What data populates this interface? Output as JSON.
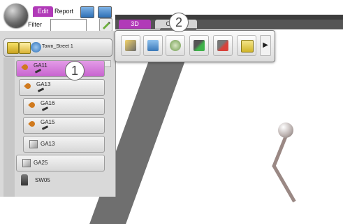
{
  "ribbon": {
    "tabs": [
      {
        "label": "Edit",
        "active": true
      },
      {
        "label": "Report",
        "active": false
      }
    ],
    "icons": [
      "view-icon",
      "save-view-icon"
    ]
  },
  "filter": {
    "label": "Filter",
    "value": ""
  },
  "view_tabs": [
    {
      "label": "3D",
      "active": true
    },
    {
      "label": "Ob  ons",
      "active": false
    }
  ],
  "tree": {
    "toolbar_label": "Town_Street 1",
    "items": [
      {
        "label": "GA11",
        "type": "sensor",
        "selected": true
      },
      {
        "label": "GA13",
        "type": "sensor",
        "selected": false
      },
      {
        "label": "GA16",
        "type": "sensor",
        "selected": false
      },
      {
        "label": "GA15",
        "type": "sensor",
        "selected": false
      },
      {
        "label": "GA13",
        "type": "cube",
        "selected": false
      },
      {
        "label": "GA25",
        "type": "cube",
        "selected": false
      }
    ],
    "footer_item": "SW05"
  },
  "float_toolbar": {
    "buttons": [
      "pencil-icon",
      "export-icon",
      "refresh-icon",
      "add-sensor-icon",
      "remove-sensor-icon",
      "info-icon"
    ],
    "more_glyph": "▶"
  },
  "callouts": [
    "1",
    "2"
  ],
  "colors": {
    "accent": "#b13ab8",
    "dark": "#3d3d3d"
  }
}
